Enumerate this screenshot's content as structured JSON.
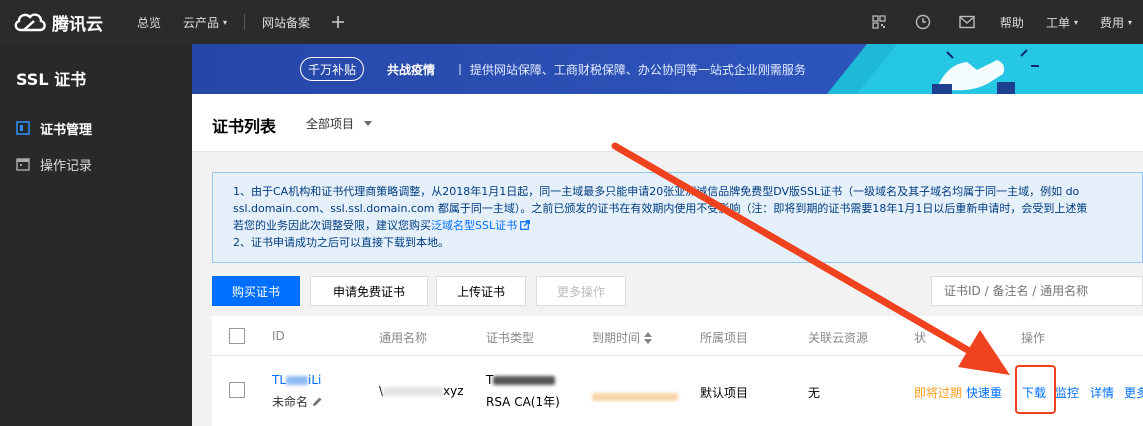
{
  "topbar": {
    "brand": "腾讯云",
    "nav": [
      {
        "label": "总览"
      },
      {
        "label": "云产品",
        "caret": true
      },
      {
        "label": "网站备案"
      }
    ],
    "right": {
      "help": "帮助",
      "ticket": "工单",
      "billing": "费用"
    },
    "icons": [
      "qr-code-icon",
      "clock-icon",
      "mail-icon",
      "plus-icon"
    ]
  },
  "sidebar": {
    "title": "SSL 证书",
    "items": [
      {
        "label": "证书管理",
        "active": true
      },
      {
        "label": "操作记录",
        "active": false
      }
    ]
  },
  "banner": {
    "badge": "千万补贴",
    "headline": "共战疫情",
    "text": "丨 提供网站保障、工商财税保障、办公协同等一站式企业刚需服务"
  },
  "header": {
    "title": "证书列表",
    "project_select": "全部项目"
  },
  "notice": {
    "line1": "1、由于CA机构和证书代理商策略调整，从2018年1月1日起，同一主域最多只能申请20张亚洲诚信品牌免费型DV版SSL证书（一级域名及其子域名均属于同一主域，例如 do",
    "line2": "ssl.domain.com、ssl.ssl.domain.com 都属于同一主域）。之前已颁发的证书在有效期内使用不受影响（注：即将到期的证书需要18年1月1日以后重新申请时，会受到上述策",
    "line3_prefix": "若您的业务因此次调整受限，建议您购买",
    "line3_link": "泛域名型SSL证书",
    "line4": "2、证书申请成功之后可以直接下载到本地。"
  },
  "toolbar": {
    "buy": "购买证书",
    "apply_free": "申请免费证书",
    "upload": "上传证书",
    "more": "更多操作",
    "search_placeholder": "证书ID / 备注名 / 通用名称"
  },
  "table": {
    "headers": {
      "id": "ID",
      "common_name": "通用名称",
      "cert_type": "证书类型",
      "expiry": "到期时间",
      "project": "所属项目",
      "resources": "关联云资源",
      "status": "状",
      "actions": "操作"
    },
    "row": {
      "id_prefix": "TL",
      "id_suffix": "iLi",
      "remark": "未命名",
      "common_name_prefix": "\\",
      "common_name_suffix": "xyz",
      "cert_type_prefix": "T",
      "cert_type_line2": "RSA CA(1年)",
      "project": "默认项目",
      "resources": "无",
      "status": "即将过期",
      "actions": {
        "renew": "快速重",
        "download": "下载",
        "monitor": "监控",
        "detail": "详情",
        "more": "更多"
      }
    }
  },
  "colors": {
    "topbar": "#2b2b2b",
    "sidebar": "#292929",
    "primary": "#006eff",
    "warning": "#ff9c19",
    "annotation": "#f0421f"
  }
}
